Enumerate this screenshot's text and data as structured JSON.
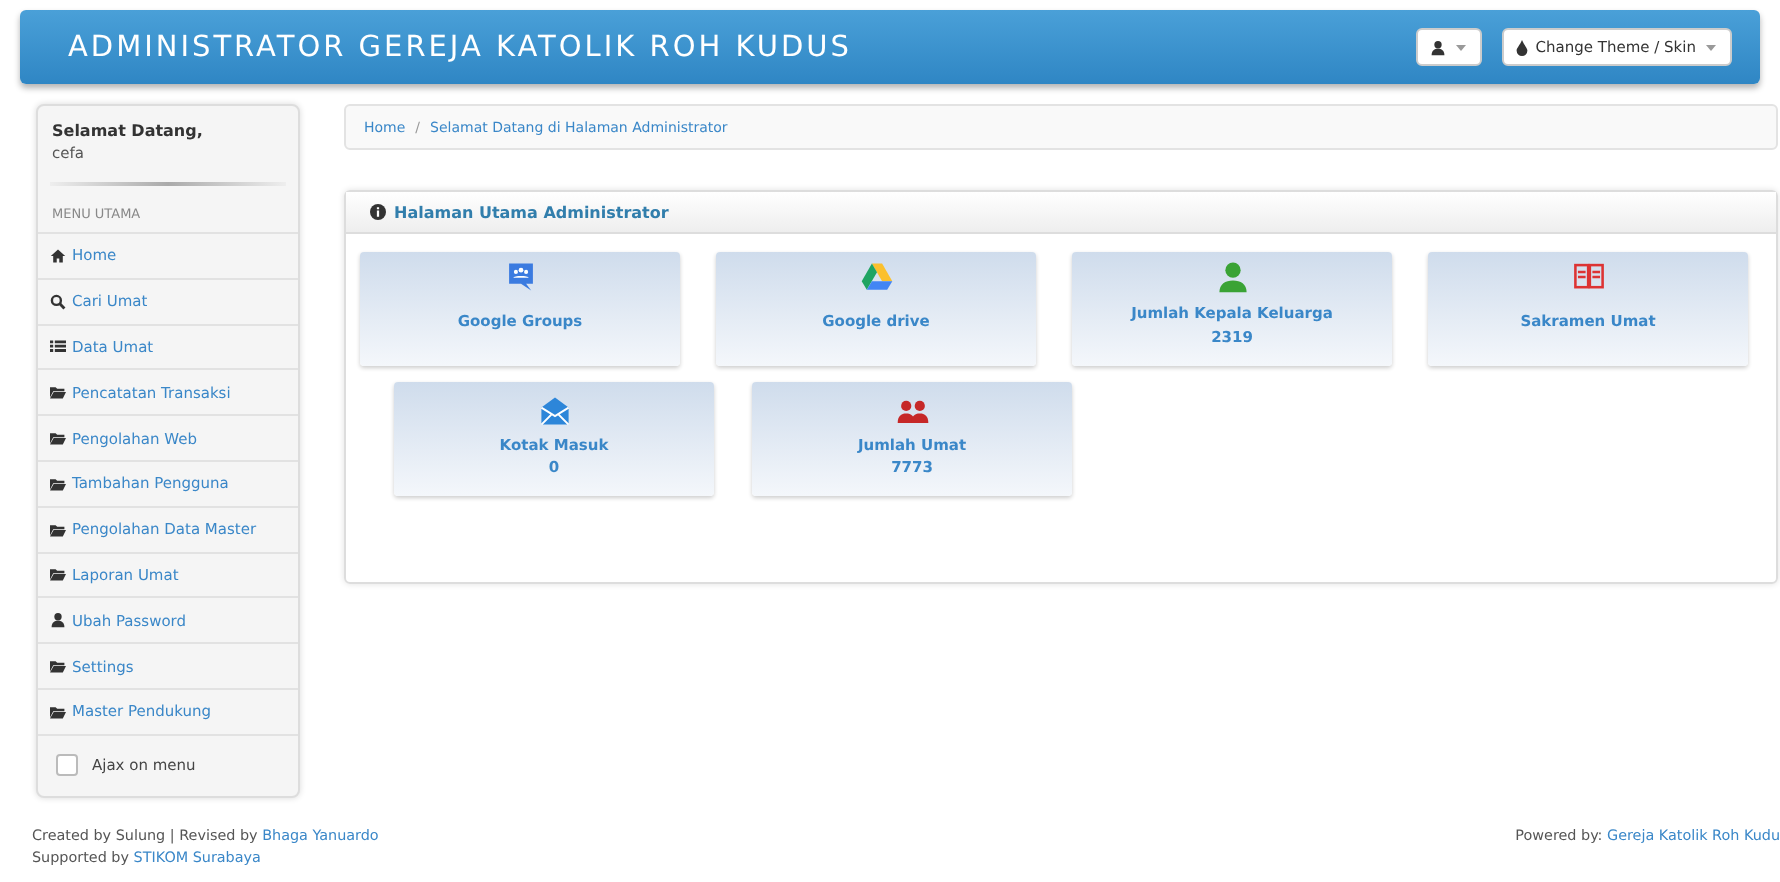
{
  "header": {
    "title": "ADMINISTRATOR GEREJA KATOLIK ROH KUDUS",
    "theme_button": "Change Theme / Skin"
  },
  "sidebar": {
    "greeting": "Selamat Datang,",
    "user": "cefa",
    "section": "MENU UTAMA",
    "items": [
      {
        "label": "Home",
        "kind": "home"
      },
      {
        "label": "Cari Umat",
        "kind": "search"
      },
      {
        "label": "Data Umat",
        "kind": "list"
      },
      {
        "label": "Pencatatan Transaksi",
        "kind": "folder"
      },
      {
        "label": "Pengolahan Web",
        "kind": "folder"
      },
      {
        "label": "Tambahan Pengguna",
        "kind": "folder"
      },
      {
        "label": "Pengolahan Data Master",
        "kind": "folder"
      },
      {
        "label": "Laporan Umat",
        "kind": "folder"
      },
      {
        "label": "Ubah Password",
        "kind": "user"
      },
      {
        "label": "Settings",
        "kind": "folder"
      },
      {
        "label": "Master Pendukung",
        "kind": "folder"
      }
    ],
    "ajax": {
      "label": "Ajax on menu",
      "checked": false
    }
  },
  "breadcrumb": {
    "items": [
      "Home",
      "Selamat Datang di Halaman Administrator"
    ],
    "separator": "/"
  },
  "panel": {
    "title": "Halaman Utama Administrator",
    "rows": [
      [
        {
          "kind": "groups",
          "label": "Google Groups"
        },
        {
          "kind": "drive",
          "label": "Google drive"
        },
        {
          "kind": "person",
          "label": "Jumlah Kepala Keluarga",
          "value": "2319"
        },
        {
          "kind": "book",
          "label": "Sakramen Umat"
        }
      ],
      [
        {
          "kind": "mail",
          "label": "Kotak Masuk",
          "value": "0"
        },
        {
          "kind": "people",
          "label": "Jumlah Umat",
          "value": "7773"
        }
      ]
    ]
  },
  "footer": {
    "left": [
      {
        "text": "Created by Sulung | Revised by ",
        "link": "Bhaga Yanuardo"
      },
      {
        "text": "Supported by ",
        "link": "STIKOM Surabaya"
      }
    ],
    "right": {
      "text": "Powered by: ",
      "link": "Gereja Katolik Roh Kudu"
    }
  }
}
